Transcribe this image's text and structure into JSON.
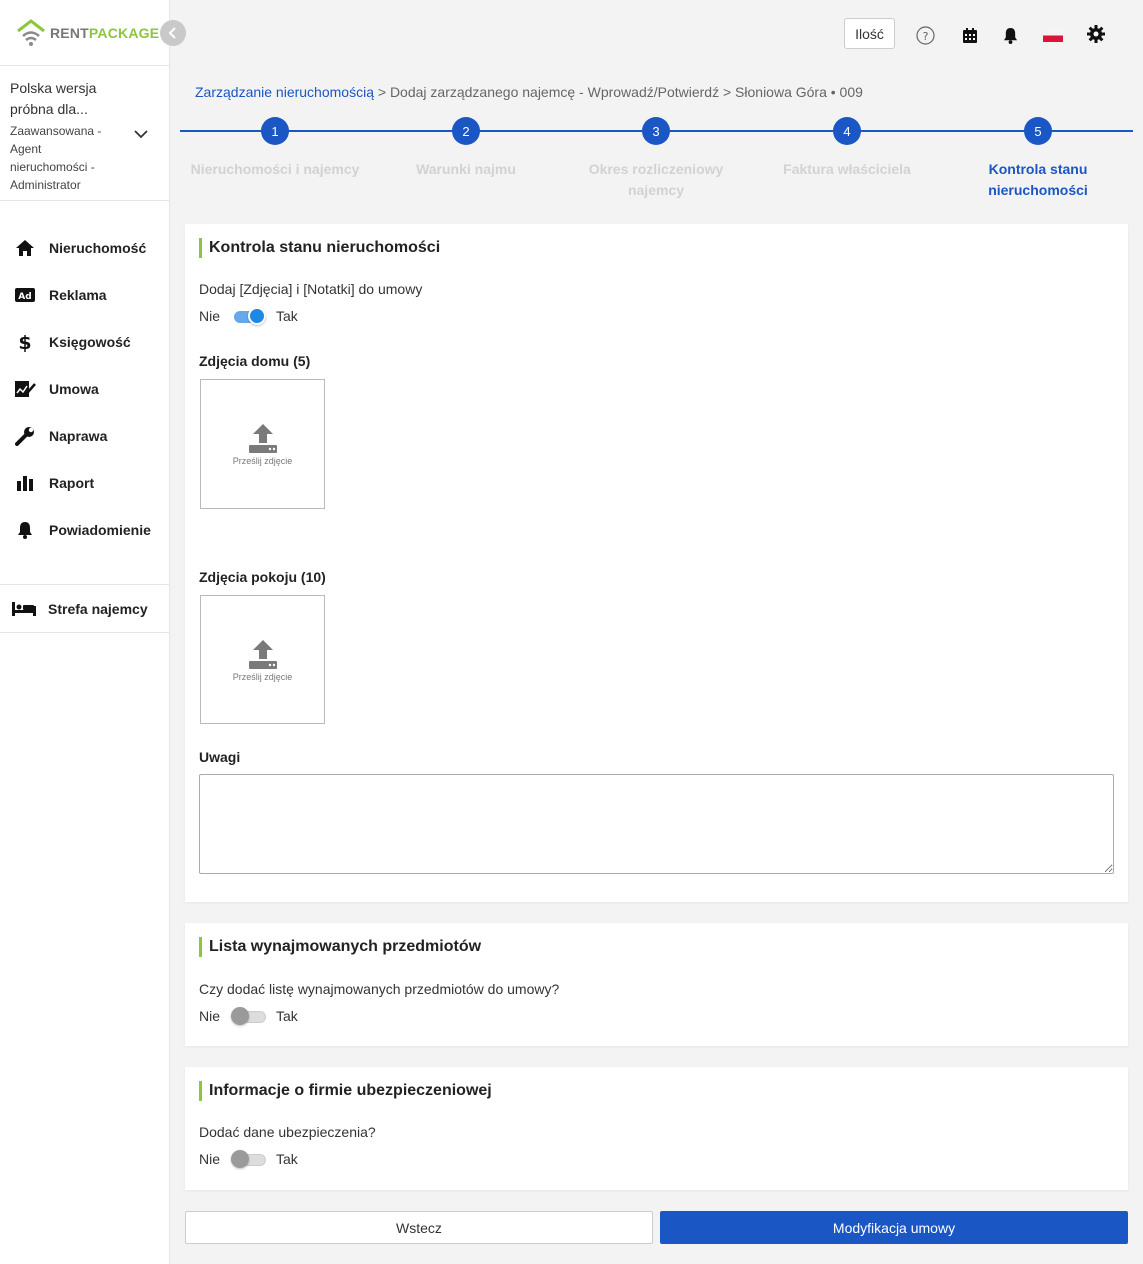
{
  "brand": {
    "rent": "RENT",
    "package": "PACKAGE",
    "green": "#8cc63f",
    "grey": "#777777"
  },
  "account": {
    "name": "Polska wersja próbna dla...",
    "role": "Zaawansowana - Agent nieruchomości - Administrator"
  },
  "sidebar": {
    "items": [
      {
        "label": "Nieruchomość",
        "icon": "home-icon"
      },
      {
        "label": "Reklama",
        "icon": "ad-icon"
      },
      {
        "label": "Księgowość",
        "icon": "dollar-icon"
      },
      {
        "label": "Umowa",
        "icon": "contract-icon"
      },
      {
        "label": "Naprawa",
        "icon": "wrench-icon"
      },
      {
        "label": "Raport",
        "icon": "bar-chart-icon"
      },
      {
        "label": "Powiadomienie",
        "icon": "bell-icon"
      }
    ],
    "tenant_zone": {
      "label": "Strefa najemcy",
      "icon": "bed-icon"
    }
  },
  "topbar": {
    "qty_label": "Ilość"
  },
  "breadcrumb": {
    "link": "Zarządzanie nieruchomością",
    "rest": " > Dodaj zarządzanego najemcę - Wprowadź/Potwierdź > Słoniowa Góra • 009"
  },
  "stepper": {
    "steps": [
      {
        "num": "1",
        "label": "Nieruchomości i najemcy"
      },
      {
        "num": "2",
        "label": "Warunki najmu"
      },
      {
        "num": "3",
        "label": "Okres rozliczeniowy najemcy"
      },
      {
        "num": "4",
        "label": "Faktura właściciela"
      },
      {
        "num": "5",
        "label": "Kontrola stanu nieruchomości"
      }
    ],
    "active_step": 5
  },
  "inspection": {
    "title": "Kontrola stanu nieruchomości",
    "question": "Dodaj [Zdjęcia] i [Notatki] do umowy",
    "no": "Nie",
    "yes": "Tak",
    "enabled": true,
    "house_photos_label": "Zdjęcia domu (5)",
    "room_photos_label": "Zdjęcia pokoju (10)",
    "upload_label": "Prześlij zdjęcie",
    "notes_label": "Uwagi",
    "notes_value": ""
  },
  "rented_items": {
    "title": "Lista wynajmowanych przedmiotów",
    "question": "Czy dodać listę wynajmowanych przedmiotów do umowy?",
    "no": "Nie",
    "yes": "Tak",
    "enabled": false
  },
  "insurance": {
    "title": "Informacje o firmie ubezpieczeniowej",
    "question": "Dodać dane ubezpieczenia?",
    "no": "Nie",
    "yes": "Tak",
    "enabled": false
  },
  "actions": {
    "back": "Wstecz",
    "submit": "Modyfikacja umowy"
  },
  "colors": {
    "primary": "#1a56c4",
    "accent": "#8cc63f",
    "toggle_on": "#1e88e5"
  }
}
